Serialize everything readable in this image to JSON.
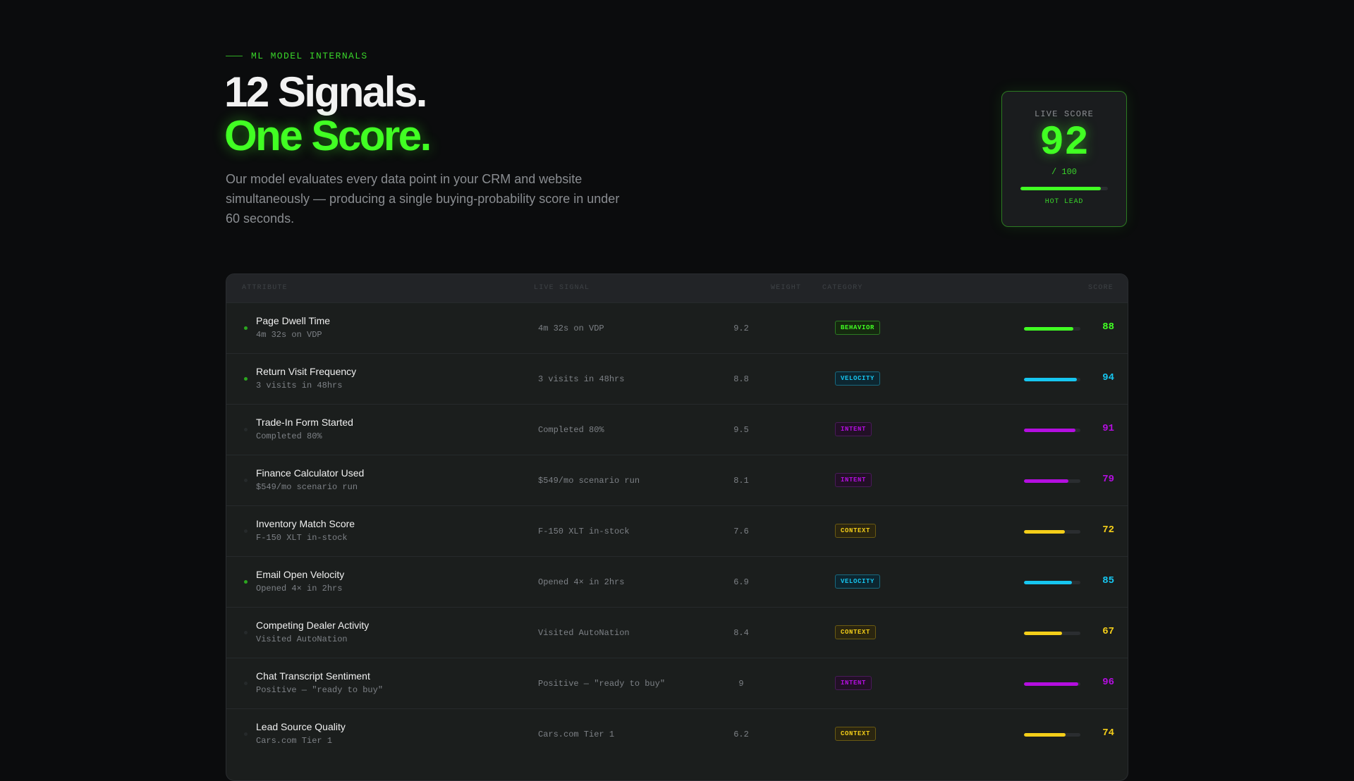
{
  "header": {
    "eyebrow": "ML MODEL INTERNALS",
    "title_line1": "12 Signals.",
    "title_line2": "One Score.",
    "description": "Our model evaluates every data point in your CRM and website simultaneously — producing a single buying-probability score in under 60 seconds."
  },
  "live_score": {
    "label": "LIVE SCORE",
    "value": "92",
    "max_label": "/ 100",
    "progress": 0.92,
    "status": "HOT LEAD"
  },
  "table": {
    "columns": {
      "attribute": "ATTRIBUTE",
      "live_signal": "LIVE SIGNAL",
      "weight": "WEIGHT",
      "category": "CATEGORY",
      "score": "SCORE"
    },
    "category_colors": {
      "BEHAVIOR": "#41ff23",
      "VELOCITY": "#16c6f0",
      "INTENT": "#b40ee0",
      "CONTEXT": "#f4ce19"
    },
    "rows": [
      {
        "name": "Page Dwell Time",
        "sub": "4m 32s on VDP",
        "signal": "4m 32s on VDP",
        "weight": "9.2",
        "category": "BEHAVIOR",
        "score": "88",
        "active": true
      },
      {
        "name": "Return Visit Frequency",
        "sub": "3 visits in 48hrs",
        "signal": "3 visits in 48hrs",
        "weight": "8.8",
        "category": "VELOCITY",
        "score": "94",
        "active": true
      },
      {
        "name": "Trade-In Form Started",
        "sub": "Completed 80%",
        "signal": "Completed 80%",
        "weight": "9.5",
        "category": "INTENT",
        "score": "91",
        "active": false
      },
      {
        "name": "Finance Calculator Used",
        "sub": "$549/mo scenario run",
        "signal": "$549/mo scenario run",
        "weight": "8.1",
        "category": "INTENT",
        "score": "79",
        "active": false
      },
      {
        "name": "Inventory Match Score",
        "sub": "F-150 XLT in-stock",
        "signal": "F-150 XLT in-stock",
        "weight": "7.6",
        "category": "CONTEXT",
        "score": "72",
        "active": false
      },
      {
        "name": "Email Open Velocity",
        "sub": "Opened 4× in 2hrs",
        "signal": "Opened 4× in 2hrs",
        "weight": "6.9",
        "category": "VELOCITY",
        "score": "85",
        "active": true
      },
      {
        "name": "Competing Dealer Activity",
        "sub": "Visited AutoNation",
        "signal": "Visited AutoNation",
        "weight": "8.4",
        "category": "CONTEXT",
        "score": "67",
        "active": false
      },
      {
        "name": "Chat Transcript Sentiment",
        "sub": "Positive — \"ready to buy\"",
        "signal": "Positive — \"ready to buy\"",
        "weight": "9",
        "category": "INTENT",
        "score": "96",
        "active": false
      },
      {
        "name": "Lead Source Quality",
        "sub": "Cars.com Tier 1",
        "signal": "Cars.com Tier 1",
        "weight": "6.2",
        "category": "CONTEXT",
        "score": "74",
        "active": false
      }
    ]
  }
}
